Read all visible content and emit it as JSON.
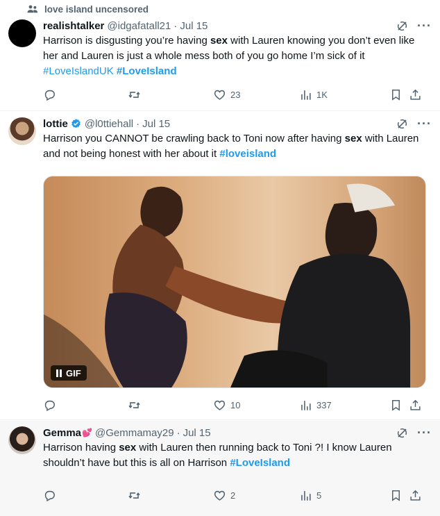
{
  "community": {
    "icon": "people-icon",
    "label": "love island uncensored"
  },
  "tweets": [
    {
      "name": "realishtalker",
      "handle": "@idgafatall21",
      "dot": "·",
      "date": "Jul 15",
      "verified": false,
      "text_parts": [
        "Harrison is disgusting you’re having ",
        "sex",
        " with Lauren knowing you don’t even like her and Lauren is just a whole mess both of you go home I’m sick of it ",
        "#LoveIslandUK",
        " ",
        "#LoveIsland"
      ],
      "stats": {
        "reply": "",
        "retweet": "",
        "like": "23",
        "views": "1K"
      }
    },
    {
      "name": "lottie",
      "handle": "@l0ttiehall",
      "dot": "·",
      "date": "Jul 15",
      "verified": true,
      "text_parts": [
        "Harrison you CANNOT be crawling back to Toni now after having ",
        "sex",
        " with Lauren and not being honest with her about it ",
        "#loveisland"
      ],
      "media": {
        "type": "gif",
        "badge": "GIF"
      },
      "stats": {
        "reply": "",
        "retweet": "",
        "like": "10",
        "views": "337"
      }
    },
    {
      "name": "Gemma",
      "name_emoji": "💕",
      "handle": "@Gemmamay29",
      "dot": "·",
      "date": "Jul 15",
      "verified": false,
      "text_parts": [
        "Harrison having ",
        "sex",
        " with Lauren then running back to Toni ?! I know Lauren shouldn’t have but this is all on Harrison  ",
        "#LoveIsland"
      ],
      "stats": {
        "reply": "",
        "retweet": "",
        "like": "2",
        "views": "5"
      }
    }
  ],
  "colors": {
    "accent": "#1d9bf0",
    "muted": "#536471",
    "text": "#0f1419",
    "verified": "#1d9bf0"
  },
  "icons": [
    "people-icon",
    "grok-icon",
    "more-icon",
    "reply-icon",
    "retweet-icon",
    "like-icon",
    "views-icon",
    "bookmark-icon",
    "share-icon",
    "verified-badge-icon",
    "pause-icon"
  ]
}
